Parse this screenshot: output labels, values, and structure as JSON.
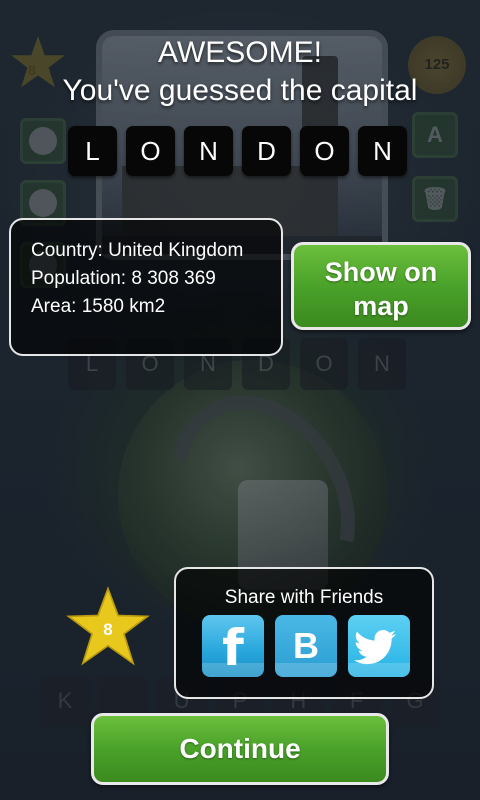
{
  "header": {
    "line1": "AWESOME!",
    "line2": "You've guessed the capital"
  },
  "answer": {
    "letters": [
      "L",
      "O",
      "N",
      "D",
      "O",
      "N"
    ]
  },
  "info": {
    "country": "Country: United Kingdom",
    "population": "Population: 8 308 369",
    "area": "Area: 1580 km2"
  },
  "map_button": {
    "label": "Show on map"
  },
  "stars": {
    "count": "8"
  },
  "background": {
    "star_count": "8",
    "coins": "125",
    "dim_letters": [
      "L",
      "O",
      "N",
      "D",
      "O",
      "N"
    ],
    "keyboard": [
      "K",
      "",
      "U",
      "P",
      "H",
      "F",
      "G"
    ]
  },
  "share": {
    "title": "Share with Friends",
    "icons": [
      "facebook-icon",
      "vk-icon",
      "twitter-icon"
    ],
    "fb_glyph": "f",
    "vk_glyph": "B"
  },
  "continue_button": {
    "label": "Continue"
  },
  "colors": {
    "green_button": "#4aa22a",
    "star_gold": "#e8c81c",
    "social_blue": "#27a6dc"
  }
}
